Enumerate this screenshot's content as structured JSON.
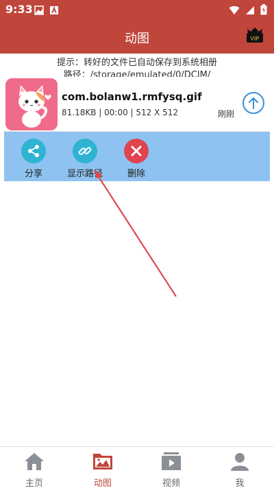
{
  "status": {
    "time": "9:33"
  },
  "header": {
    "title": "动图",
    "vip_badge": "VIP"
  },
  "hint": {
    "line1": "提示：转好的文件已自动保存到系统相册",
    "line2": "路径：/storage/emulated/0/DCIM/"
  },
  "file": {
    "name": "com.bolanw1.rmfysq.gif",
    "meta": "81.18KB | 00:00 | 512 X 512",
    "time": "刚刚"
  },
  "actions": {
    "share": "分享",
    "show_path": "显示路径",
    "delete": "删除"
  },
  "nav": {
    "items": [
      {
        "label": "主页",
        "icon": "home-icon"
      },
      {
        "label": "动图",
        "icon": "gif-image-icon"
      },
      {
        "label": "视频",
        "icon": "video-icon"
      },
      {
        "label": "我",
        "icon": "profile-icon"
      }
    ]
  },
  "colors": {
    "header": "#c0453b",
    "action_bar": "#8ec2f0",
    "share": "#2fb3d3",
    "delete": "#e0444f",
    "active_nav": "#c0453b",
    "upload": "#3a8fd6"
  }
}
